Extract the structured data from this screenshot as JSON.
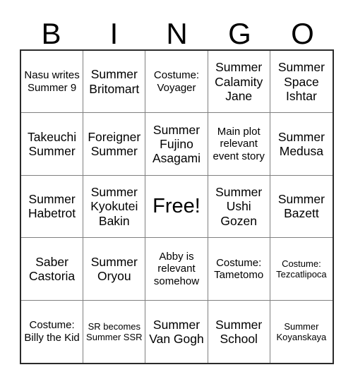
{
  "card": {
    "header_letters": [
      "B",
      "I",
      "N",
      "G",
      "O"
    ],
    "rows": [
      [
        {
          "text": "Nasu writes Summer 9",
          "size": "sm"
        },
        {
          "text": "Summer Britomart",
          "size": "md"
        },
        {
          "text": "Costume: Voyager",
          "size": "sm"
        },
        {
          "text": "Summer Calamity Jane",
          "size": "md"
        },
        {
          "text": "Summer Space Ishtar",
          "size": "md"
        }
      ],
      [
        {
          "text": "Takeuchi Summer",
          "size": "md"
        },
        {
          "text": "Foreigner Summer",
          "size": "md"
        },
        {
          "text": "Summer Fujino Asagami",
          "size": "md"
        },
        {
          "text": "Main plot relevant event story",
          "size": "sm"
        },
        {
          "text": "Summer Medusa",
          "size": "md"
        }
      ],
      [
        {
          "text": "Summer Habetrot",
          "size": "md"
        },
        {
          "text": "Summer Kyokutei Bakin",
          "size": "md"
        },
        {
          "text": "Free!",
          "size": "lg"
        },
        {
          "text": "Summer Ushi Gozen",
          "size": "md"
        },
        {
          "text": "Summer Bazett",
          "size": "md"
        }
      ],
      [
        {
          "text": "Saber Castoria",
          "size": "md"
        },
        {
          "text": "Summer Oryou",
          "size": "md"
        },
        {
          "text": "Abby is relevant somehow",
          "size": "sm"
        },
        {
          "text": "Costume: Tametomo",
          "size": "sm"
        },
        {
          "text": "Costume: Tezcatlipoca",
          "size": "xs"
        }
      ],
      [
        {
          "text": "Costume: Billy the Kid",
          "size": "sm"
        },
        {
          "text": "SR becomes Summer SSR",
          "size": "xs"
        },
        {
          "text": "Summer Van Gogh",
          "size": "md"
        },
        {
          "text": "Summer School",
          "size": "md"
        },
        {
          "text": "Summer Koyanskaya",
          "size": "xs"
        }
      ]
    ]
  },
  "colors": {
    "background": "#ffffff",
    "grid_outline": "#2b2b2b",
    "grid_divider": "#808080",
    "text": "#000000"
  }
}
